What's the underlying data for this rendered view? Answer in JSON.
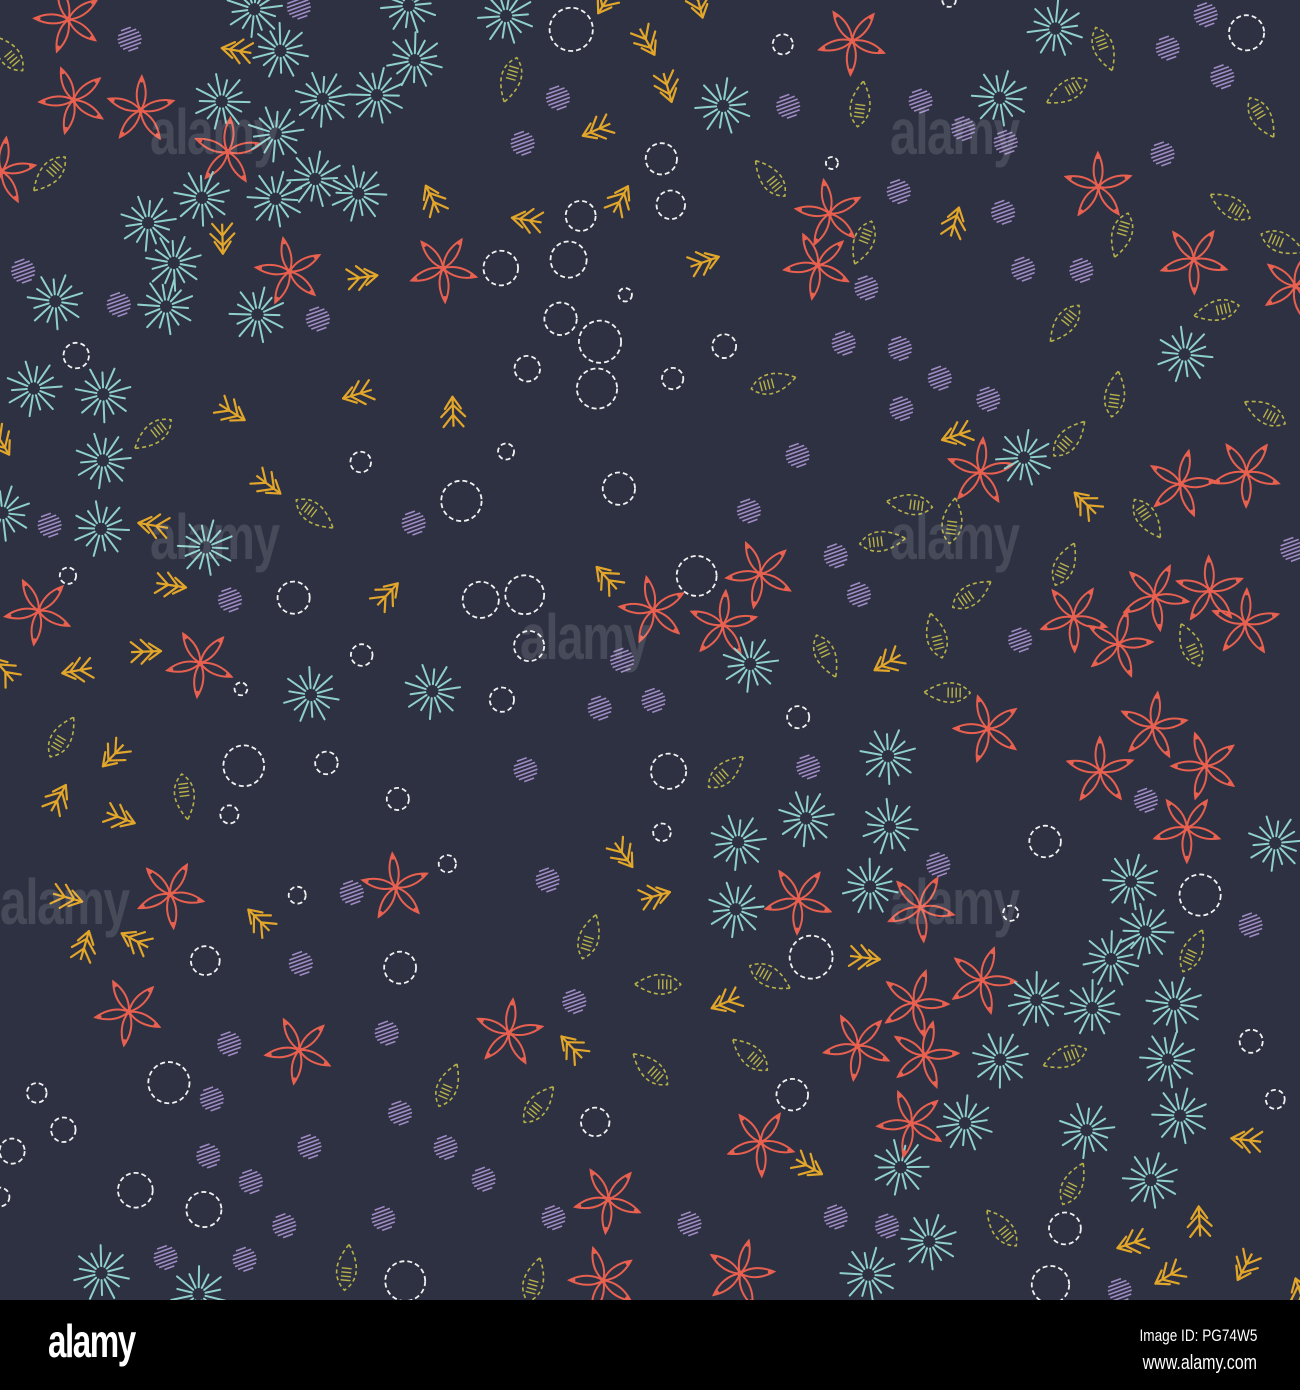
{
  "image": {
    "watermark": "alamy",
    "colors": {
      "background": "#2e3142",
      "flower": "#e8604f",
      "starburst": "#8fd0cc",
      "leaf": "#e2a62a",
      "circle": "#f2f2f2",
      "dot": "#a08bc4",
      "drop": "#b7b14a"
    }
  },
  "footer": {
    "logo": "alamy",
    "image_id": "Image ID: PG74W5",
    "url": "www.alamy.com"
  }
}
